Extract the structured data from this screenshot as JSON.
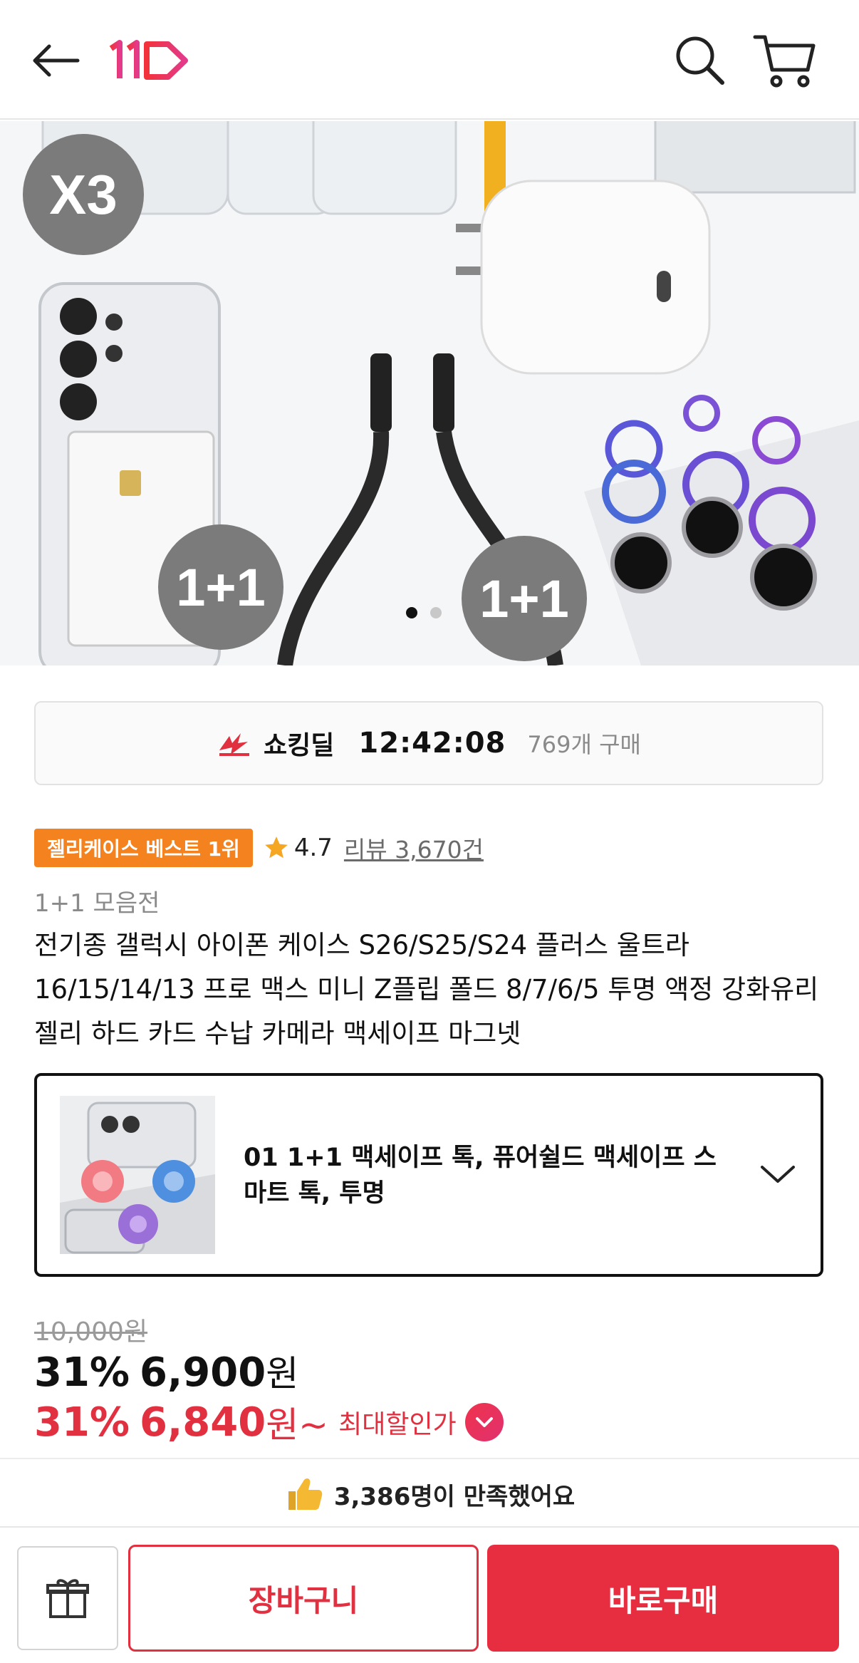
{
  "header": {
    "back_icon": "arrow-left-icon",
    "logo_icon": "11st-logo",
    "search_icon": "search-icon",
    "cart_icon": "cart-icon"
  },
  "hero": {
    "badge_x3": "X3",
    "badge_1p1_a": "1+1",
    "badge_1p1_b": "1+1",
    "carousel_total": 2,
    "carousel_active": 1
  },
  "deal": {
    "icon": "shocking-deal-icon",
    "label": "쇼킹딜",
    "timer": "12:42:08",
    "sold": "769개 구매"
  },
  "meta": {
    "best_badge": "젤리케이스 베스트 1위",
    "rating": "4.7",
    "reviews": "리뷰 3,670건"
  },
  "product": {
    "category": "1+1 모음전",
    "title": "전기종 갤럭시 아이폰 케이스 S26/S25/S24 플러스 울트라 16/15/14/13 프로 맥스 미니 Z플립 폴드 8/7/6/5 투명 액정 강화유리 젤리 하드 카드 수납 카메라 맥세이프 마그넷"
  },
  "option": {
    "selected": "01 1+1 맥세이프 톡, 퓨어쉴드 맥세이프 스마트 톡, 투명"
  },
  "price": {
    "original": "10,000원",
    "discount_pct": "31%",
    "sale_amount": "6,900",
    "sale_unit": "원",
    "max_pct": "31%",
    "max_amount": "6,840",
    "max_unit": "원~",
    "max_label": "최대할인가"
  },
  "satisfaction": {
    "text": "3,386명이 만족했어요"
  },
  "bottom_bar": {
    "gift_icon": "gift-icon",
    "cart_label": "장바구니",
    "buy_label": "바로구매"
  },
  "colors": {
    "accent_red": "#e72d40",
    "badge_orange": "#f3821f",
    "star": "#f5a623"
  }
}
